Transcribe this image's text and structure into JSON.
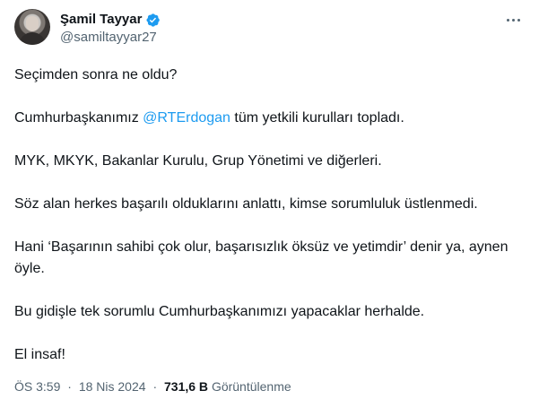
{
  "author": {
    "display_name": "Şamil Tayyar",
    "handle": "@samiltayyar27"
  },
  "tweet": {
    "line1": "Seçimden sonra ne oldu?",
    "line2_prefix": "Cumhurbaşkanımız ",
    "line2_mention": "@RTErdogan",
    "line2_suffix": " tüm yetkili kurulları topladı.",
    "line3": "MYK, MKYK, Bakanlar Kurulu, Grup Yönetimi ve diğerleri.",
    "line4": "Söz alan herkes başarılı olduklarını anlattı, kimse sorumluluk üstlenmedi.",
    "line5": "Hani ‘Başarının sahibi çok olur, başarısızlık öksüz ve yetimdir’ denir ya, aynen öyle.",
    "line6": "Bu gidişle tek sorumlu Cumhurbaşkanımızı yapacaklar herhalde.",
    "line7": "El insaf!"
  },
  "meta": {
    "time": "ÖS 3:59",
    "separator": "·",
    "date": "18 Nis 2024",
    "views_count": "731,6 B",
    "views_label": "Görüntülenme"
  },
  "colors": {
    "accent": "#1d9bf0",
    "text": "#0f1419",
    "muted": "#536471"
  },
  "icons": {
    "verified": "verified-badge-icon",
    "more": "more-options-icon"
  }
}
